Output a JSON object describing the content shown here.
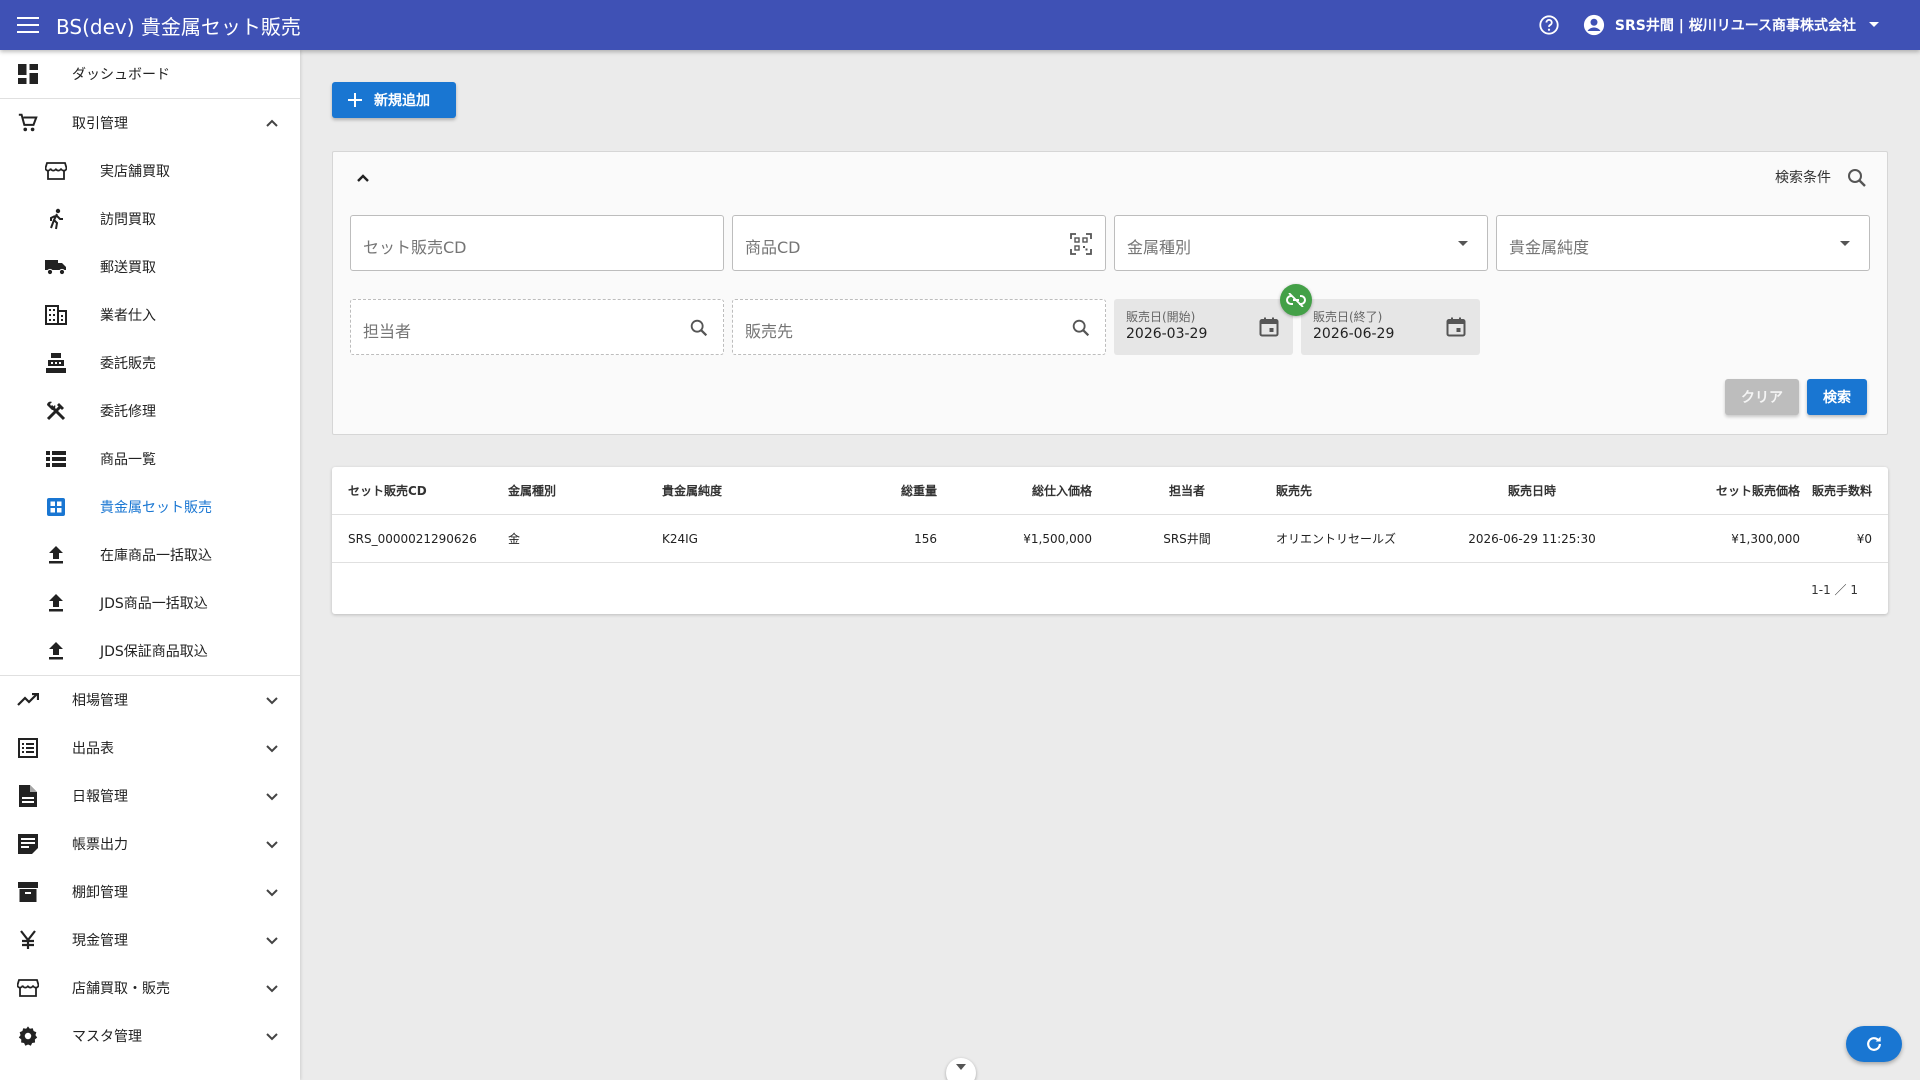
{
  "appbar": {
    "title": "BS(dev) 貴金属セット販売",
    "user_label": "SRS井間 | 桜川リユース商事株式会社"
  },
  "sidebar": {
    "items": [
      {
        "label": "ダッシュボード",
        "icon": "dashboard-icon"
      },
      {
        "label": "取引管理",
        "icon": "cart-icon",
        "expanded": true
      },
      {
        "label": "実店舗買取",
        "icon": "store-icon"
      },
      {
        "label": "訪問買取",
        "icon": "walk-icon"
      },
      {
        "label": "郵送買取",
        "icon": "truck-icon"
      },
      {
        "label": "業者仕入",
        "icon": "building-icon"
      },
      {
        "label": "委託販売",
        "icon": "register-icon"
      },
      {
        "label": "委託修理",
        "icon": "tools-icon"
      },
      {
        "label": "商品一覧",
        "icon": "list-icon"
      },
      {
        "label": "貴金属セット販売",
        "icon": "grid-icon",
        "active": true
      },
      {
        "label": "在庫商品一括取込",
        "icon": "upload-icon"
      },
      {
        "label": "JDS商品一括取込",
        "icon": "upload-icon"
      },
      {
        "label": "JDS保証商品取込",
        "icon": "upload-icon"
      },
      {
        "label": "相場管理",
        "icon": "trending-icon"
      },
      {
        "label": "出品表",
        "icon": "list-alt-icon"
      },
      {
        "label": "日報管理",
        "icon": "document-icon"
      },
      {
        "label": "帳票出力",
        "icon": "note-icon"
      },
      {
        "label": "棚卸管理",
        "icon": "archive-icon"
      },
      {
        "label": "現金管理",
        "icon": "yen-icon"
      },
      {
        "label": "店舗買取・販売",
        "icon": "store-icon"
      },
      {
        "label": "マスタ管理",
        "icon": "gear-icon"
      }
    ]
  },
  "main": {
    "add_button": "新規追加",
    "search": {
      "conditions_label": "検索条件",
      "set_cd_placeholder": "セット販売CD",
      "product_cd_placeholder": "商品CD",
      "metal_type_placeholder": "金属種別",
      "purity_placeholder": "貴金属純度",
      "staff_placeholder": "担当者",
      "customer_placeholder": "販売先",
      "date_start_label": "販売日(開始)",
      "date_start_value": "2026-03-29",
      "date_end_label": "販売日(終了)",
      "date_end_value": "2026-06-29",
      "clear_button": "クリア",
      "search_button": "検索"
    },
    "table": {
      "headers": [
        "セット販売CD",
        "金属種別",
        "貴金属純度",
        "総重量",
        "総仕入価格",
        "担当者",
        "販売先",
        "販売日時",
        "セット販売価格",
        "販売手数料"
      ],
      "rows": [
        [
          "SRS_0000021290626",
          "金",
          "K24IG",
          "156",
          "¥1,500,000",
          "SRS井間",
          "オリエントリセールズ",
          "2026-06-29 11:25:30",
          "¥1,300,000",
          "¥0"
        ]
      ],
      "pagination": "1-1 ／ 1"
    }
  },
  "colors": {
    "appbar": "#3f51b5",
    "primary": "#1976d2",
    "link_badge": "#43a047"
  }
}
